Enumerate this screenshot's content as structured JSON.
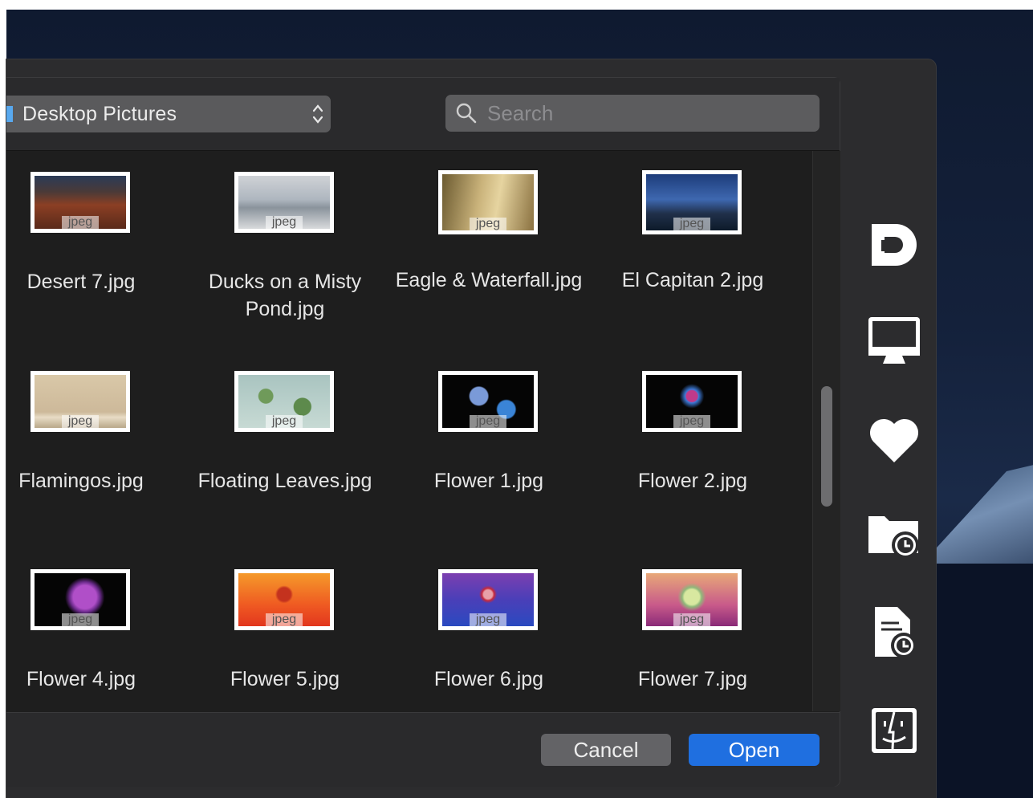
{
  "location": {
    "label": "Desktop Pictures"
  },
  "search": {
    "placeholder": "Search"
  },
  "files": [
    {
      "name": "Desert 7.jpg",
      "tag": "jpeg"
    },
    {
      "name": "Ducks on a Misty Pond.jpg",
      "tag": "jpeg"
    },
    {
      "name": "Eagle & Waterfall.jpg",
      "tag": "jpeg"
    },
    {
      "name": "El Capitan 2.jpg",
      "tag": "jpeg"
    },
    {
      "name": "Flamingos.jpg",
      "tag": "jpeg"
    },
    {
      "name": "Floating Leaves.jpg",
      "tag": "jpeg"
    },
    {
      "name": "Flower 1.jpg",
      "tag": "jpeg"
    },
    {
      "name": "Flower 2.jpg",
      "tag": "jpeg"
    },
    {
      "name": "Flower 4.jpg",
      "tag": "jpeg"
    },
    {
      "name": "Flower 5.jpg",
      "tag": "jpeg"
    },
    {
      "name": "Flower 6.jpg",
      "tag": "jpeg"
    },
    {
      "name": "Flower 7.jpg",
      "tag": "jpeg"
    }
  ],
  "buttons": {
    "cancel": "Cancel",
    "open": "Open"
  },
  "sidebar": {
    "icons": [
      "dropbox-icon",
      "desktop-icon",
      "favorites-heart-icon",
      "recent-folder-icon",
      "recent-documents-icon",
      "finder-icon"
    ]
  },
  "colors": {
    "accent": "#1f6fe0",
    "folder": "#58a8ee"
  }
}
